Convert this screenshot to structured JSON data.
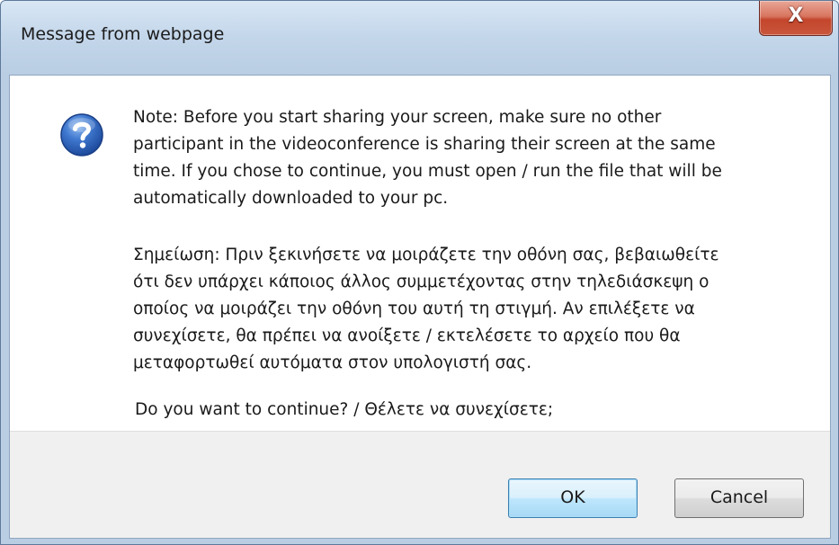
{
  "window": {
    "title": "Message from webpage",
    "close_glyph": "X",
    "close_icon": "close-icon"
  },
  "dialog": {
    "icon": "question-icon",
    "note_en": [
      "Note: Before you start sharing your screen, make sure no other",
      "participant in the videoconference is sharing their screen at the same",
      "time. If you chose to continue, you must open / run the file that will be",
      "automatically downloaded to your pc."
    ],
    "note_gr": [
      "Σημείωση: Πριν ξεκινήσετε να μοιράζετε την οθόνη σας, βεβαιωθείτε",
      "ότι δεν υπάρχει κάποιος άλλος συμμετέχοντας στην τηλεδιάσκεψη ο",
      "οποίος να μοιράζει την οθόνη του αυτή τη στιγμή. Αν επιλέξετε να",
      "συνεχίσετε, θα πρέπει να ανοίξετε / εκτελέσετε το αρχείο που θα",
      "μεταφορτωθεί αυτόματα στον υπολογιστή σας."
    ],
    "question": "Do you want to continue? / Θέλετε να συνεχίσετε;"
  },
  "buttons": {
    "ok_label": "OK",
    "cancel_label": "Cancel"
  },
  "colors": {
    "titlebar": "#c3d6ea",
    "close_button": "#c9563b",
    "ok_border": "#3c7fb1",
    "icon_blue": "#2f63b8"
  }
}
